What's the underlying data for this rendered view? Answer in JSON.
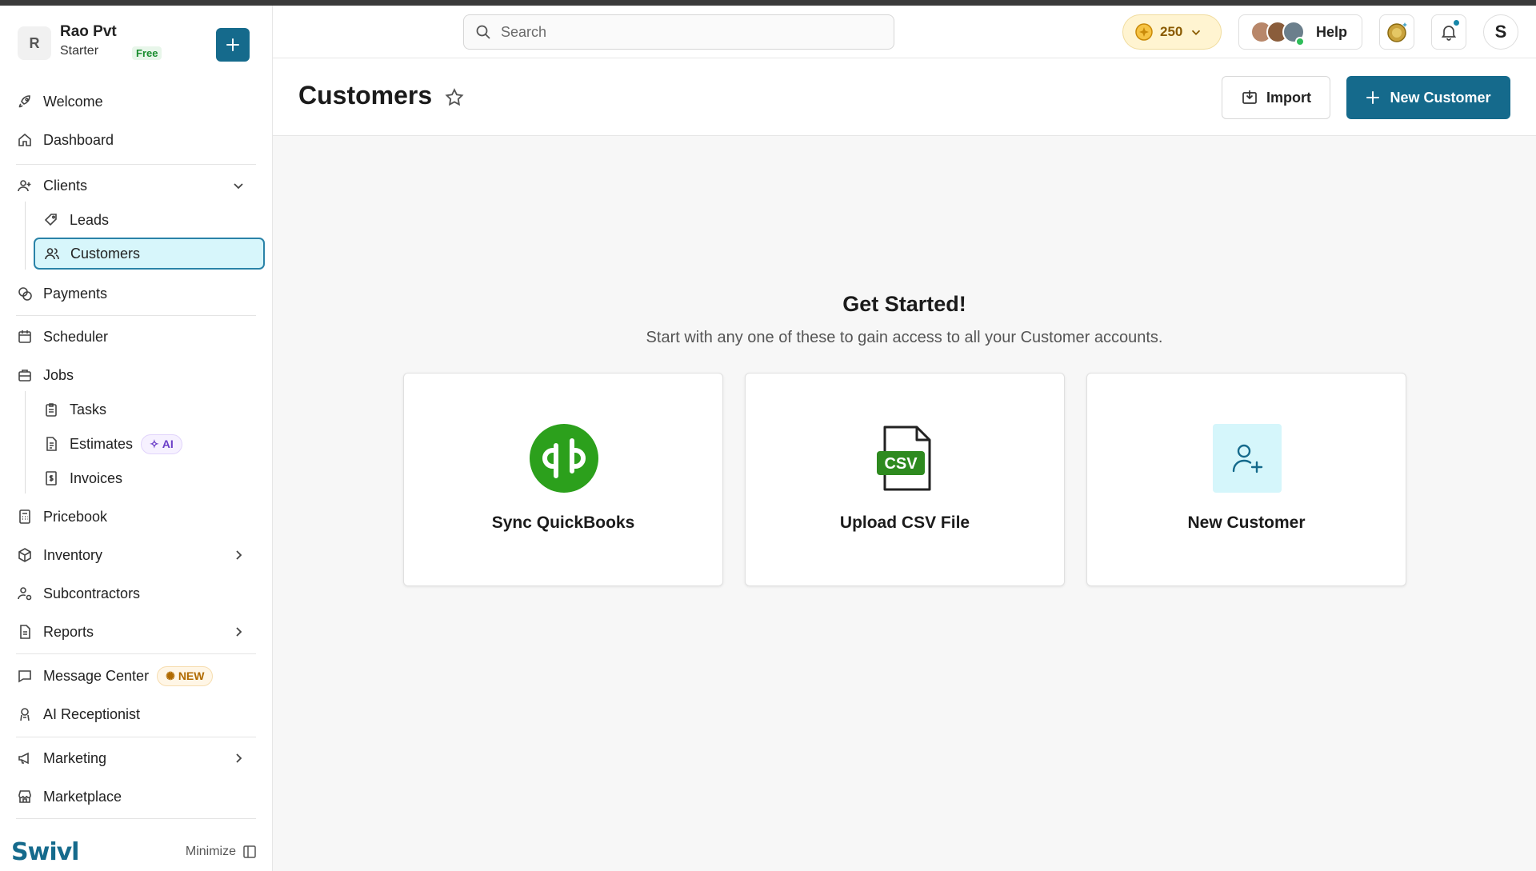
{
  "org": {
    "initial": "R",
    "name": "Rao Pvt",
    "plan": "Starter",
    "plan_badge": "Free"
  },
  "search": {
    "placeholder": "Search"
  },
  "credits": {
    "value": "250"
  },
  "help": {
    "label": "Help"
  },
  "user": {
    "initial": "S"
  },
  "nav": {
    "welcome": "Welcome",
    "dashboard": "Dashboard",
    "clients": "Clients",
    "leads": "Leads",
    "customers": "Customers",
    "payments": "Payments",
    "scheduler": "Scheduler",
    "jobs": "Jobs",
    "tasks": "Tasks",
    "estimates": "Estimates",
    "estimates_badge": "AI",
    "invoices": "Invoices",
    "pricebook": "Pricebook",
    "inventory": "Inventory",
    "subcontractors": "Subcontractors",
    "reports": "Reports",
    "message_center": "Message Center",
    "message_center_badge": "NEW",
    "ai_receptionist": "AI Receptionist",
    "marketing": "Marketing",
    "marketplace": "Marketplace"
  },
  "footer": {
    "logo": "Swivl",
    "minimize": "Minimize"
  },
  "page": {
    "title": "Customers",
    "import_label": "Import",
    "new_customer_label": "New Customer"
  },
  "empty_state": {
    "title": "Get Started!",
    "subtitle": "Start with any one of these to gain access to all your Customer accounts.",
    "cards": [
      {
        "label": "Sync QuickBooks",
        "icon": "quickbooks-icon"
      },
      {
        "label": "Upload CSV File",
        "icon": "csv-file-icon",
        "icon_text": "CSV"
      },
      {
        "label": "New Customer",
        "icon": "add-user-icon"
      }
    ]
  },
  "colors": {
    "brand": "#156a8c",
    "active_bg": "#d7f6fb",
    "quickbooks": "#2ca01c"
  }
}
